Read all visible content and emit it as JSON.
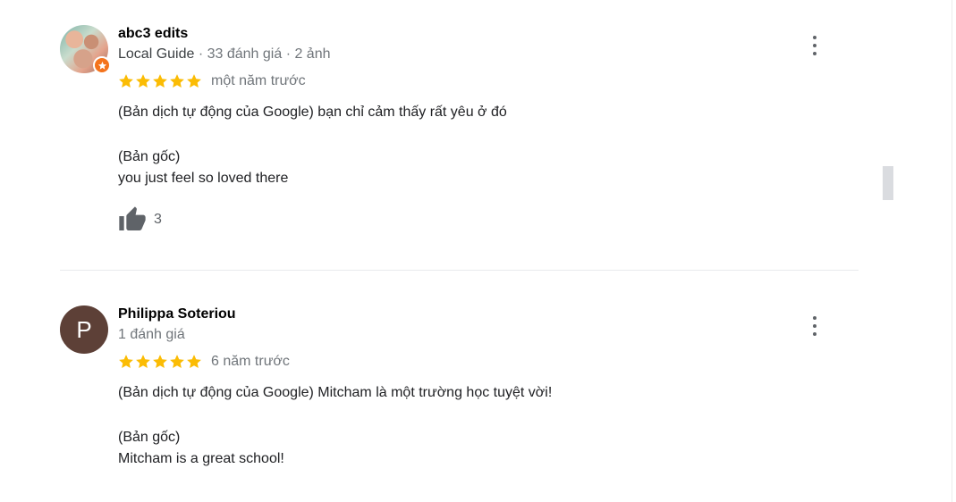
{
  "reviews": [
    {
      "author": "abc3 edits",
      "avatar_letter": "",
      "guide_label": "Local Guide",
      "meta": " · 33 đánh giá · 2 ảnh",
      "stars": 5,
      "time": "một năm trước",
      "translated": "(Bản dịch tự động của Google) bạn chỉ cảm thấy rất yêu ở đó",
      "original_label": "(Bản gốc)",
      "original": "you just feel so loved there",
      "likes": "3"
    },
    {
      "author": "Philippa Soteriou",
      "avatar_letter": "P",
      "meta": "1 đánh giá",
      "stars": 5,
      "time": "6 năm trước",
      "translated": "(Bản dịch tự động của Google) Mitcham là một trường học tuyệt vời!",
      "original_label": "(Bản gốc)",
      "original": "Mitcham is a great school!"
    }
  ],
  "colors": {
    "star": "#fbbc04",
    "avatar_p": "#5d4037",
    "local_guide_badge": "#f4731c"
  }
}
